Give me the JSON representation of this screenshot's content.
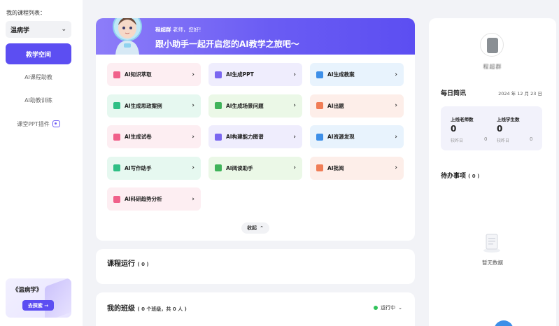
{
  "sidebar": {
    "course_list_label": "我的课程列表：",
    "selected_course": "温病学",
    "nav_active": "教学空间",
    "nav_items": [
      "AI课程助教",
      "AI助教训练",
      "课堂PPT插件"
    ],
    "promo_title": "《温病学》",
    "promo_button": "去探索 →"
  },
  "banner": {
    "teacher_name": "程超群",
    "greeting": "老师，您好!",
    "headline": "跟小助手一起开启您的AI教学之旅吧～"
  },
  "tools": [
    {
      "label": "AI知识萃取",
      "color": "pink",
      "icon": "knowledge-icon"
    },
    {
      "label": "AI生成PPT",
      "color": "lav",
      "icon": "ppt-icon"
    },
    {
      "label": "AI生成教案",
      "color": "sky",
      "icon": "lesson-plan-icon"
    },
    {
      "label": "AI生成思政案例",
      "color": "mint",
      "icon": "document-icon"
    },
    {
      "label": "AI生成场景问题",
      "color": "lime",
      "icon": "layers-icon"
    },
    {
      "label": "AI出题",
      "color": "peach",
      "icon": "quiz-icon"
    },
    {
      "label": "AI生成试卷",
      "color": "pink",
      "icon": "exam-icon"
    },
    {
      "label": "AI构建能力图谱",
      "color": "lav",
      "icon": "graph-icon"
    },
    {
      "label": "AI资源发现",
      "color": "sky",
      "icon": "resource-icon"
    },
    {
      "label": "AI写作助手",
      "color": "mint",
      "icon": "pen-icon"
    },
    {
      "label": "AI阅读助手",
      "color": "lime",
      "icon": "book-icon"
    },
    {
      "label": "AI批阅",
      "color": "peach",
      "icon": "grading-icon"
    },
    {
      "label": "AI科研趋势分析",
      "color": "pink",
      "icon": "chart-icon"
    }
  ],
  "collapse_label": "收起",
  "course_running": {
    "title": "课程运行",
    "count": "( 0 )"
  },
  "my_classes": {
    "title": "我的班级",
    "summary": "( 0 个班级，共 0 人 )",
    "status": "运行中"
  },
  "right": {
    "user_name": "程超群",
    "news_title": "每日简讯",
    "news_date": "2024 年 12 月 23 日",
    "teachers_label": "上线老师数",
    "teachers_value": "0",
    "teachers_prev_label": "较昨日",
    "teachers_prev_value": "0",
    "students_label": "上线学生数",
    "students_value": "0",
    "students_prev_label": "较昨日",
    "students_prev_value": "0",
    "todo_title": "待办事项",
    "todo_count": "( 0 )",
    "empty_text": "暂无数据"
  }
}
